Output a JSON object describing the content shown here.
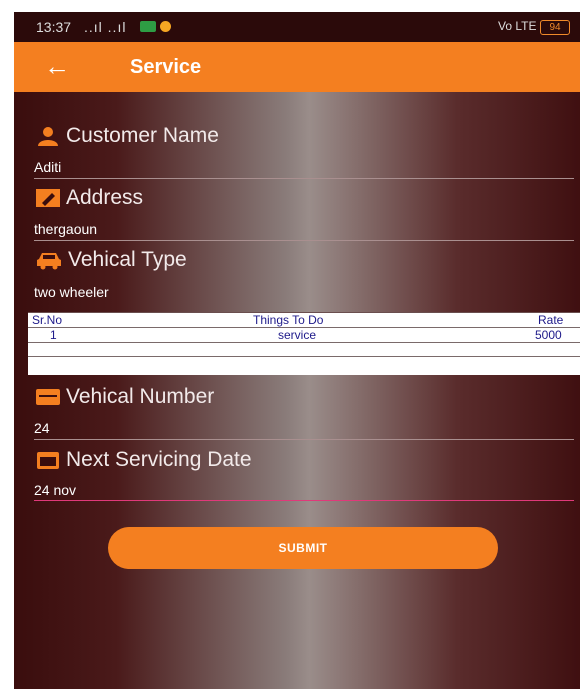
{
  "status": {
    "time": "13:37",
    "signal": "..ıl ..ıl",
    "right_icons": "Vo LTE",
    "battery": "94"
  },
  "appbar": {
    "back_icon": "arrow-left-icon",
    "title": "Service"
  },
  "form": {
    "customer_name": {
      "label": "Customer Name",
      "value": "Aditi",
      "icon": "person-icon"
    },
    "address": {
      "label": "Address",
      "value": "thergaoun",
      "icon": "edit-icon"
    },
    "vehicle_type": {
      "label": "Vehical Type",
      "value": "two wheeler",
      "icon": "car-icon"
    },
    "vehicle_number": {
      "label": "Vehical Number",
      "value": "24",
      "icon": "plate-icon"
    },
    "next_date": {
      "label": "Next Servicing Date",
      "value": "24 nov",
      "icon": "calendar-icon"
    }
  },
  "table": {
    "headers": [
      "Sr.No",
      "Things To Do",
      "Rate"
    ],
    "rows": [
      [
        "1",
        "service",
        "5000"
      ]
    ]
  },
  "submit_label": "SUBMIT",
  "colors": {
    "accent": "#f47f20",
    "focus_line": "#e0397a",
    "table_text": "#1e1a8a"
  }
}
